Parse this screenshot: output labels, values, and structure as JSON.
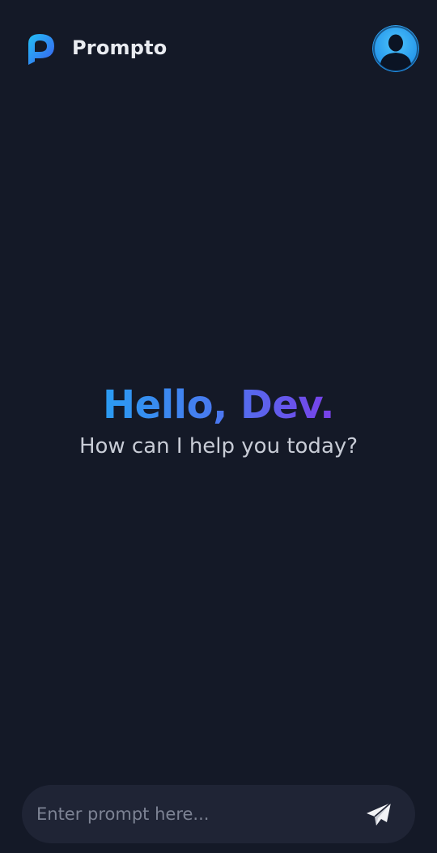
{
  "header": {
    "brand": "Prompto",
    "logo_icon": "prompto-p-logo-icon",
    "avatar_icon": "user-avatar-icon"
  },
  "greeting": {
    "hello": "Hello, Dev.",
    "subtitle": "How can I help you today?"
  },
  "composer": {
    "placeholder": "Enter prompt here...",
    "value": "",
    "send_icon": "paper-plane-send-icon"
  },
  "colors": {
    "background": "#141927",
    "input_background": "#1f2435",
    "gradient_start": "#2a9cf2",
    "gradient_end": "#7a3fe9",
    "avatar_blue": "#2aa7f5"
  }
}
